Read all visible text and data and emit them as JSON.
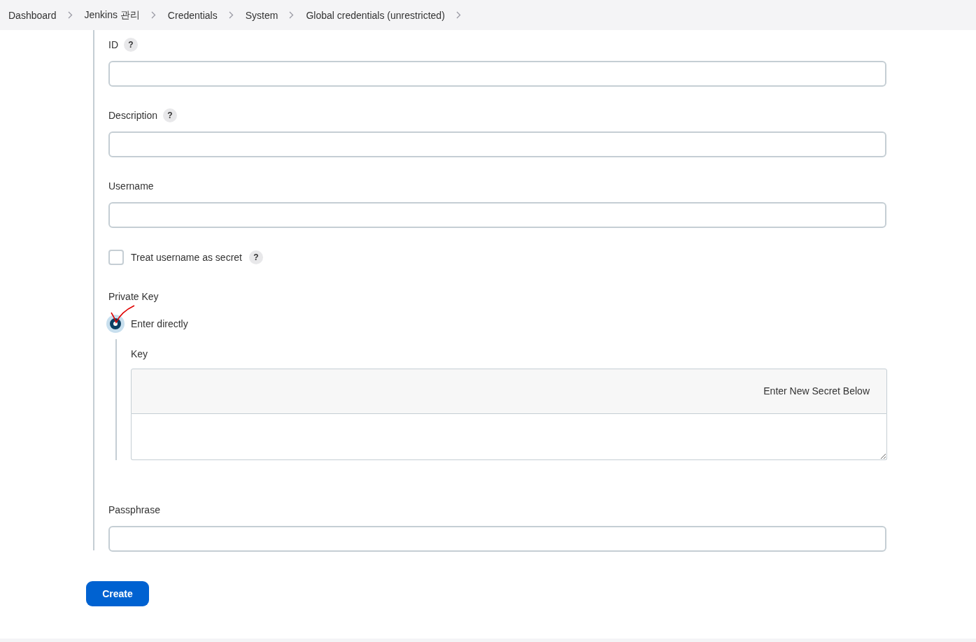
{
  "breadcrumbs": [
    {
      "label": "Dashboard"
    },
    {
      "label": "Jenkins 관리"
    },
    {
      "label": "Credentials"
    },
    {
      "label": "System"
    },
    {
      "label": "Global credentials (unrestricted)"
    }
  ],
  "fields": [
    {
      "kind": "text",
      "label": "ID",
      "help": "?"
    },
    {
      "kind": "text",
      "label": "Description",
      "help": "?"
    },
    {
      "kind": "text",
      "label": "Username"
    },
    {
      "kind": "checkbox",
      "label": "Treat username as secret",
      "checked": false,
      "help": "?"
    },
    {
      "kind": "radio",
      "label": "Private Key",
      "options": [
        {
          "label": "Enter directly",
          "selected": true,
          "annotated": true,
          "key_label": "Key",
          "secret_banner": "Enter New Secret Below"
        }
      ]
    },
    {
      "kind": "text",
      "label": "Passphrase"
    }
  ],
  "submit": "Create"
}
